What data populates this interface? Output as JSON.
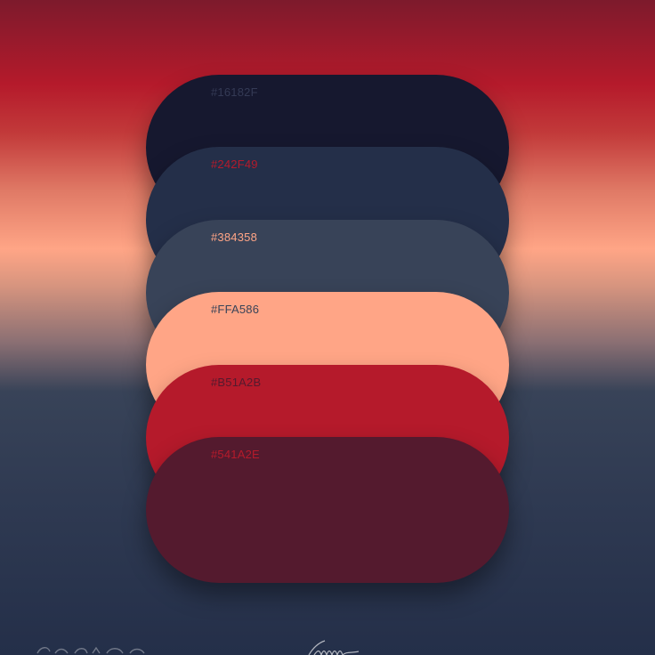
{
  "palette": {
    "swatches": [
      {
        "hex": "#16182F",
        "color": "#16182f",
        "label_color": "#343a55"
      },
      {
        "hex": "#242F49",
        "color": "#242f49",
        "label_color": "#b51a2b"
      },
      {
        "hex": "#384358",
        "color": "#384358",
        "label_color": "#ffa586"
      },
      {
        "hex": "#FFA586",
        "color": "#ffa586",
        "label_color": "#384358"
      },
      {
        "hex": "#B51A2B",
        "color": "#b51a2b",
        "label_color": "#541a2e"
      },
      {
        "hex": "#541A2E",
        "color": "#541a2e",
        "label_color": "#b51a2b"
      }
    ]
  }
}
